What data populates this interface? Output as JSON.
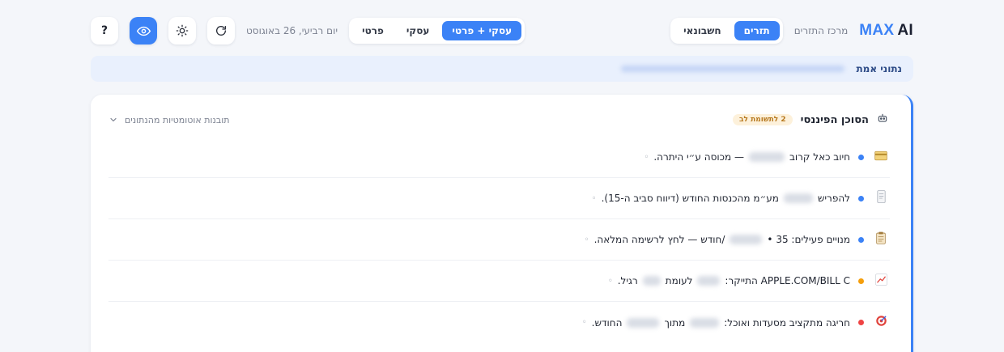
{
  "brand": {
    "name_max": "MAX",
    "name_ai": "AI",
    "subtitle": "מרכז התזרים"
  },
  "tabs": [
    {
      "label": "תזרים",
      "active": true
    },
    {
      "label": "חשבונאי",
      "active": false
    }
  ],
  "scope": [
    {
      "label": "עסקי + פרטי",
      "active": true
    },
    {
      "label": "עסקי",
      "active": false
    },
    {
      "label": "פרטי",
      "active": false
    }
  ],
  "date": "יום רביעי, 26 באוגוסט",
  "icons": {
    "refresh": "refresh-icon",
    "theme": "sun-icon",
    "privacy": "eye-icon",
    "help": "?"
  },
  "banner": {
    "label": "נתוני אמת"
  },
  "agent": {
    "title": "הסוכן הפיננסי",
    "badge": "2 לתשומת לב",
    "insights_toggle": "תובנות אוטומטיות מהנתונים"
  },
  "insights": [
    {
      "icon": "credit-card-icon",
      "dot": "#3b82f6",
      "before": "חיוב כאל קרוב",
      "after": "— מכוסה ע״י היתרה.",
      "blur": 44
    },
    {
      "icon": "receipt-icon",
      "dot": "#3b82f6",
      "before": "להפריש",
      "after": "מע״מ מהכנסות החודש (דיווח סביב ה-15).",
      "blur": 36
    },
    {
      "icon": "clipboard-icon",
      "dot": "#3b82f6",
      "before": "מנויים פעילים: 35 •",
      "after": "/חודש — לחץ לרשימה המלאה.",
      "blur": 40
    },
    {
      "icon": "chart-up-icon",
      "dot": "#f59e0b",
      "before": "APPLE.COM/BILL C התייקר:",
      "after": "לעומת",
      "after2": "רגיל.",
      "blur": 28,
      "blur2": 22
    },
    {
      "icon": "target-icon",
      "dot": "#ef4444",
      "before": "חריגה מתקציב מסעדות ואוכל:",
      "after": "מתוך",
      "after2": "החודש.",
      "blur": 36,
      "blur2": 40
    }
  ],
  "tail_glyph": "◦"
}
